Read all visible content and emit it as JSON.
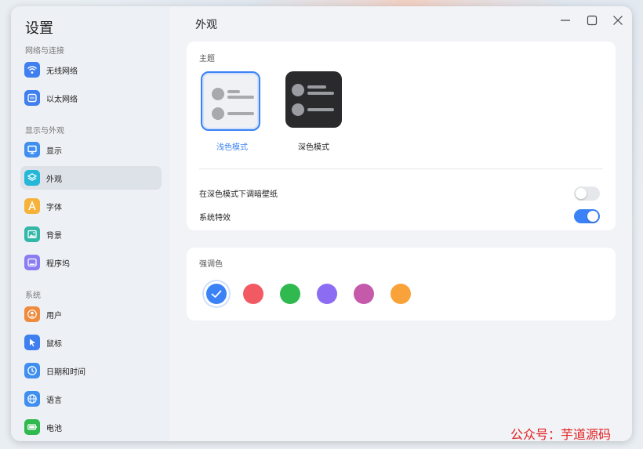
{
  "sidebar": {
    "title": "设置",
    "sections": [
      {
        "label": "网络与连接"
      },
      {
        "label": "显示与外观"
      },
      {
        "label": "系统"
      }
    ],
    "items": [
      {
        "label": "无线网络",
        "icon": "wifi-icon",
        "color": "#3f7ff0"
      },
      {
        "label": "以太网络",
        "icon": "ethernet-icon",
        "color": "#3f7ff0"
      },
      {
        "label": "显示",
        "icon": "monitor-icon",
        "color": "#3f8ff0"
      },
      {
        "label": "外观",
        "icon": "layers-icon",
        "color": "#25b7d8"
      },
      {
        "label": "字体",
        "icon": "font-icon",
        "color": "#f7b23a"
      },
      {
        "label": "背景",
        "icon": "image-icon",
        "color": "#33b7a8"
      },
      {
        "label": "程序坞",
        "icon": "dock-icon",
        "color": "#8a7cf2"
      },
      {
        "label": "用户",
        "icon": "user-icon",
        "color": "#f08a3c"
      },
      {
        "label": "鼠标",
        "icon": "cursor-icon",
        "color": "#3f7ff0"
      },
      {
        "label": "日期和时间",
        "icon": "clock-icon",
        "color": "#3f8ff0"
      },
      {
        "label": "语言",
        "icon": "globe-icon",
        "color": "#3f8ff0"
      },
      {
        "label": "电池",
        "icon": "battery-icon",
        "color": "#2fb94f"
      }
    ],
    "active_item": "外观"
  },
  "header": {
    "title": "外观"
  },
  "theme": {
    "label": "主题",
    "light_label": "浅色模式",
    "dark_label": "深色模式",
    "selected": "浅色模式"
  },
  "settings": {
    "dim_wallpaper_label": "在深色模式下调暗壁纸",
    "dim_wallpaper_on": false,
    "effects_label": "系统特效",
    "effects_on": true
  },
  "accent": {
    "label": "强调色",
    "colors": [
      "#3b82f6",
      "#f25a63",
      "#2fb94f",
      "#8b6cf2",
      "#c55aaa",
      "#f9a23a"
    ],
    "selected_index": 0
  },
  "colors": {
    "accent": "#3b82f6"
  },
  "watermark": "公众号：芋道源码"
}
